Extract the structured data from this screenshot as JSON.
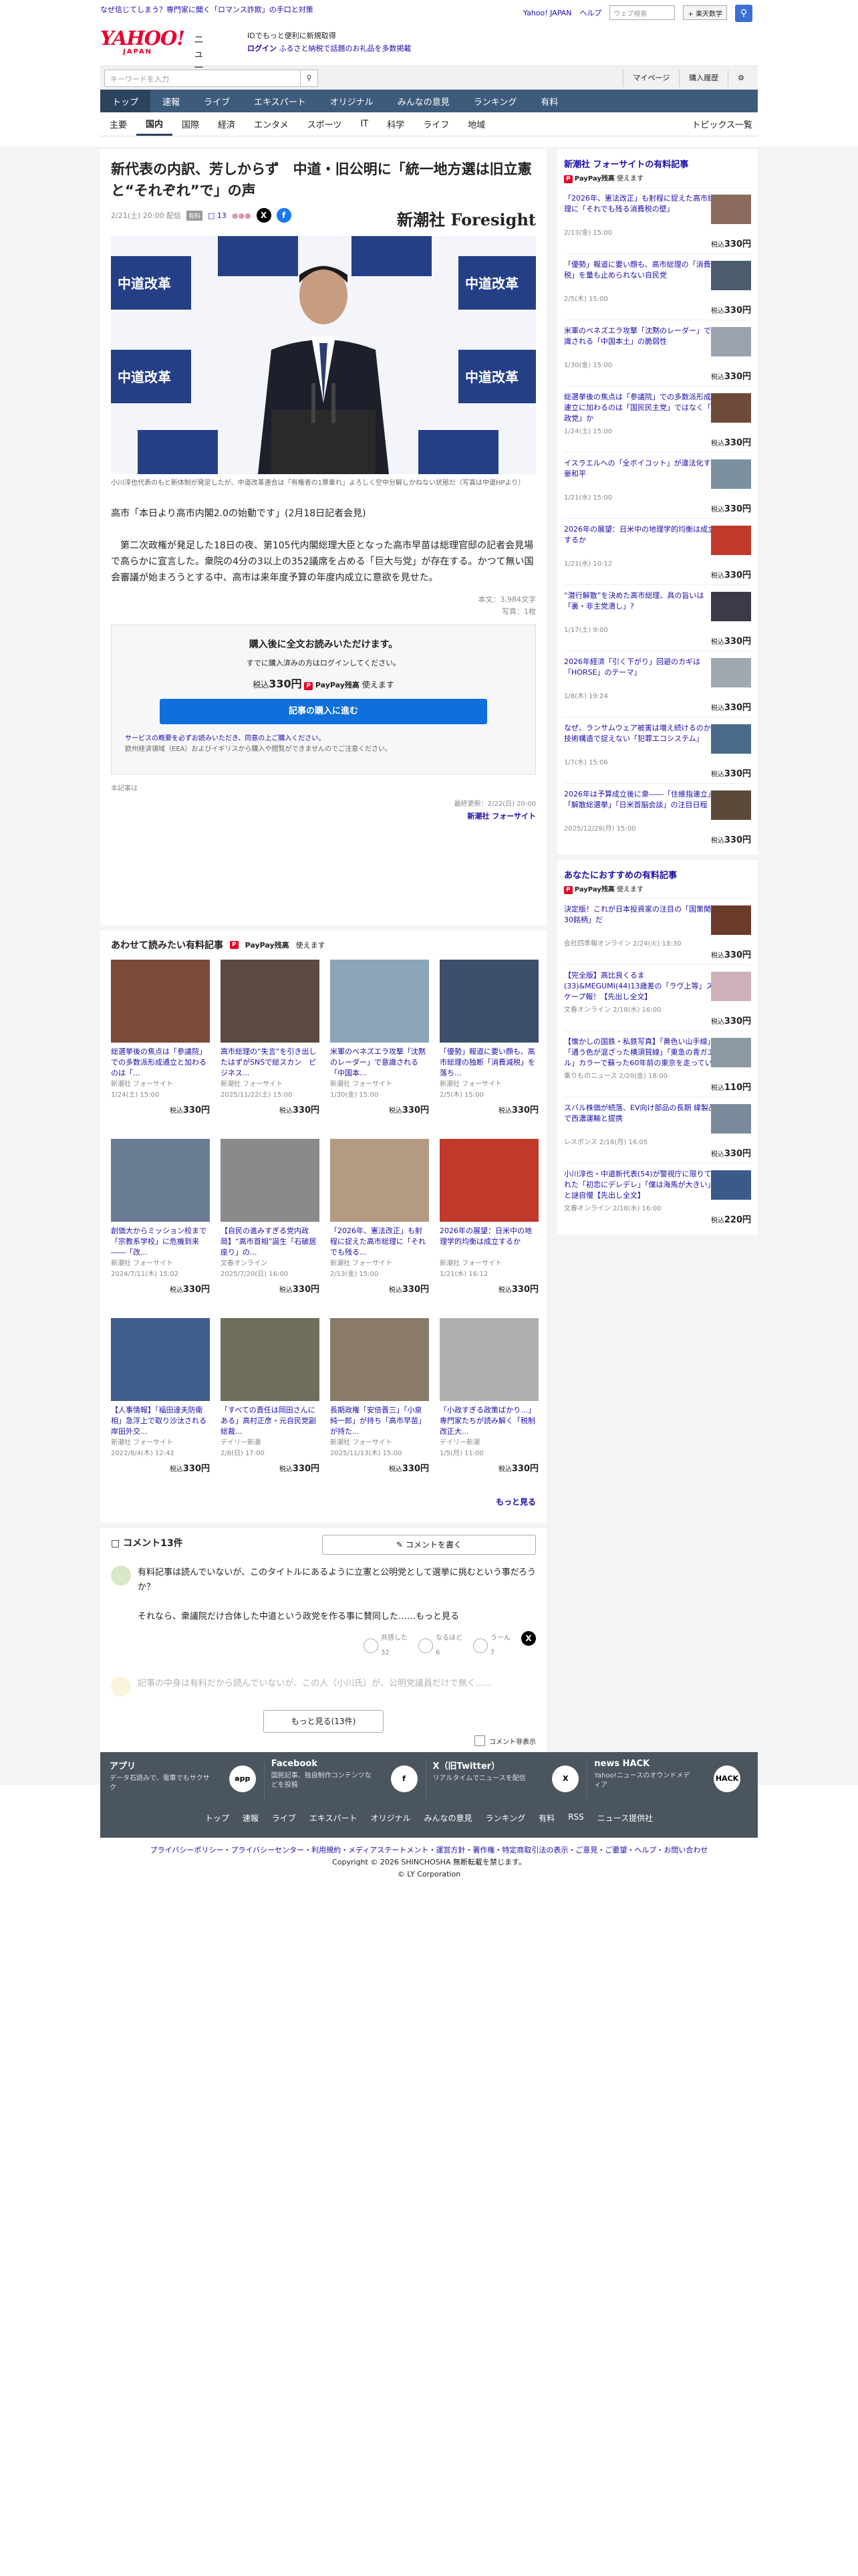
{
  "top_strip": {
    "left": "なぜ信じてしまう？専門家に聞く「ロマンス詐欺」の手口と対策",
    "right_links": [
      "Yahoo! JAPAN",
      "ヘルプ"
    ],
    "search_placeholder": "ウェブ検索",
    "search_button": "+ 楽天数学"
  },
  "header": {
    "logo": "YAHOO!",
    "logo_sub": "JAPAN",
    "service": "ニュース",
    "promo_line1": "IDでもっと便利に新規取得",
    "promo_line2_login": "ログイン",
    "promo_line2": "ふるさと納税で話題のお礼品を多数掲載"
  },
  "toolbar": {
    "search_placeholder": "キーワードを入力",
    "links": [
      "マイページ",
      "購入履歴"
    ]
  },
  "main_nav": [
    "トップ",
    "速報",
    "ライブ",
    "エキスパート",
    "オリジナル",
    "みんなの意見",
    "ランキング",
    "有料"
  ],
  "sub_nav": [
    "主要",
    "国内",
    "国際",
    "経済",
    "エンタメ",
    "スポーツ",
    "IT",
    "科学",
    "ライフ",
    "地域"
  ],
  "sub_nav_right": "トピックス一覧",
  "article": {
    "title": "新代表の内訳、芳しからず　中道・旧公明に「統一地方選は旧立憲と“それぞれ”で」の声",
    "date": "2/21(土) 20:00 配信",
    "ad": "有料",
    "comments": "13",
    "publisher": "新潮社 Foresight",
    "photo_sign": "中道改革連合",
    "caption": "小川淳也代表のもと新体制が発足したが、中道改革連合は「有権者の1票乗れ」よろしく空中分解しかねない状態だ（写真は中道HPより）",
    "body": "高市「本日より高市内閣2.0の始動です」(2月18日記者会見)\n\n　第二次政権が発足した18日の夜、第105代内閣総理大臣となった高市早苗は総理官邸の記者会見場で高らかに宣言した。衆院の4分の3以上の352議席を占める「巨大与党」が存在する。かつて無い国会審議が始まろうとする中、高市は来年度予算の年度内成立に意欲を見せた。",
    "chars": "本文：3,984文字",
    "photos": "写真：1枚",
    "paywall_title": "購入後に全文お読みいただけます。",
    "paywall_login": "すでに購入済みの方はログインしてください。",
    "price_label": "税込",
    "price": "330円",
    "paypay": "PayPay残高",
    "paypay_use": "使えます",
    "buy_button": "記事の購入に進む",
    "note1": "サービスの概要を必ずお読みいただき、同意の上ご購入ください。",
    "note2": "欧州経済領域（EEA）およびイギリスから購入や閲覧ができませんのでご注意ください。",
    "publisher_note": "最終更新：2/22(日) 20:00",
    "footer_pub": "新潮社 フォーサイト",
    "origin": "本記事は"
  },
  "related": {
    "title": "あわせて読みたい有料記事",
    "paypay": "PayPay残高",
    "paypay_use": "使えます",
    "more": "もっと見る",
    "items": [
      {
        "title": "総選挙後の焦点は「参議院」での多数派形成通立と加わるのは「...",
        "src": "新潮社 フォーサイト",
        "date": "1/24(土) 15:00",
        "price": "330円"
      },
      {
        "title": "高市総理の“失言”を引き出したはずがSNSで総スカン　ビジネス...",
        "src": "新潮社 フォーサイト",
        "date": "2025/11/22(土) 15:00",
        "price": "330円"
      },
      {
        "title": "米軍のベネズエラ攻撃「沈黙のレーダー」で意識される「中国本...",
        "src": "新潮社 フォーサイト",
        "date": "1/30(金) 15:00",
        "price": "330円"
      },
      {
        "title": "「優勢」報道に要い顔も、高市総理の独断「消費減税」を落ち...",
        "src": "新潮社 フォーサイト",
        "date": "2/5(木) 15:00",
        "price": "330円"
      },
      {
        "title": "創価大からミッション校まで「宗教系学校」に危機到来――「改...",
        "src": "新潮社 フォーサイト",
        "date": "2024/7/11(木) 15:02",
        "price": "330円"
      },
      {
        "title": "【自民の進みすぎる党内政局】“高市首相”誕生「石破居座り」の...",
        "src": "文春オンライン",
        "date": "2025/7/20(日) 16:00",
        "price": "330円"
      },
      {
        "title": "「2026年、憲法改正」も射程に捉えた高市総理に「それでも残る...",
        "src": "新潮社 フォーサイト",
        "date": "2/13(金) 15:00",
        "price": "330円"
      },
      {
        "title": "2026年の展望：日米中の地理学的均衡は成立するか",
        "src": "新潮社 フォーサイト",
        "date": "1/21(水) 16:12",
        "price": "330円"
      },
      {
        "title": "【人事情報】「福田達夫防衛相」急浮上で取り沙汰される岸田外交...",
        "src": "新潮社 フォーサイト",
        "date": "2022/8/4(木) 12:42",
        "price": "330円"
      },
      {
        "title": "「すべての責任は岡田さんにある」高村正彦・元自民党副総裁...",
        "src": "デイリー新潮",
        "date": "2/8(日) 17:00",
        "price": "330円"
      },
      {
        "title": "長期政権「安倍晋三」「小泉純一郎」が持ち「高市早苗」が持た...",
        "src": "新潮社 フォーサイト",
        "date": "2025/11/13(木) 15:00",
        "price": "330円"
      },
      {
        "title": "「小政すぎる政策ばかり…」専門家たちが読み解く「税制改正大...",
        "src": "デイリー新潮",
        "date": "1/5(月) 11:00",
        "price": "330円"
      }
    ]
  },
  "comments": {
    "title": "コメント13件",
    "write": "コメントを書く",
    "items": [
      {
        "text": "有料記事は読んでいないが、このタイトルにあるように立憲と公明党として選挙に挑むという事だろうか？\n\nそれなら、衆議院だけ合体した中道という政党を作る事に賛同した……もっと見る",
        "r1_label": "共感した",
        "r1": "32",
        "r2_label": "なるほど",
        "r2": "6",
        "r3_label": "うーん",
        "r3": "7"
      },
      {
        "text": "記事の中身は有料だから読んでいないが、この人（小川氏）が、公明党議員だけで無く......",
        "r1_label": "",
        "r1": "",
        "r2_label": "",
        "r2": "",
        "r3_label": "",
        "r3": ""
      }
    ],
    "more": "もっと見る(13件)",
    "hide": "コメント非表示"
  },
  "sidebar": {
    "sec1_title": "新潮社 フォーサイトの有料記事",
    "paypay": "PayPay残高",
    "paypay_use": "使えます",
    "sec1": [
      {
        "t": "「2026年、憲法改正」も射程に捉えた高市総理に「それでも残る消費税の壁」",
        "d": "2/13(金) 15:00",
        "p": "330円"
      },
      {
        "t": "「優勢」報道に要い顔も、高市総理の「消費減税」を量も止められない自民党",
        "d": "2/5(木) 15:00",
        "p": "330円"
      },
      {
        "t": "米軍のベネズエラ攻撃「沈黙のレーダー」で意識される「中国本土」の脆弱性",
        "d": "1/30(金) 15:00",
        "p": "330円"
      },
      {
        "t": "総選挙後の焦点は「参議院」での多数派形成　連立に加わるのは「国民民主党」ではなく「参政党」か",
        "d": "1/24(土) 15:00",
        "p": "330円"
      },
      {
        "t": "イスラエルへの「全ボイコット」が違法化する豪和平",
        "d": "1/21(水) 15:00",
        "p": "330円"
      },
      {
        "t": "2026年の展望：日米中の地理学的均衡は成立するか",
        "d": "1/21(水) 10:12",
        "p": "330円"
      },
      {
        "t": "“潜行解散”を決めた高市総理、具の旨いは「裏・非主党潰し」?",
        "d": "1/17(土) 9:00",
        "p": "330円"
      },
      {
        "t": "2026年経済「引く下がり」回避のカギは「HORSE」のテーマ」",
        "d": "1/8(木) 19:24",
        "p": "330円"
      },
      {
        "t": "なぜ、ランサムウェア被害は増え続けるのか　技術構造で捉えない「犯罪エコシステム」",
        "d": "1/7(水) 15:06",
        "p": "330円"
      },
      {
        "t": "2026年は予算成立後に衆――「住維指連立」「解散総選挙」「日米首脳会談」の注目日程",
        "d": "2025/12/29(月) 15:00",
        "p": "330円"
      }
    ],
    "sec2_title": "あなたにおすすめの有料記事",
    "sec2": [
      {
        "t": "決定版！これが日本投資家の注目の「国策関連30銘柄」だ",
        "d": "会社四季報オンライン 2/24(火) 18:30",
        "p": "330円"
      },
      {
        "t": "【完全版】高比良くるま(33)&MEGUMI(44)13歳差の「ラヴ上等」スケープ報！【先出し全文】",
        "d": "文春オンライン 2/18(水) 16:00",
        "p": "330円"
      },
      {
        "t": "【懐かしの国鉄・私鉄写真】「黄色い山手線」「通う色が混ざった横須賀線」「東急の青ガエル」カラーで蘇った60年前の東京を走っていた鉄道の“色”",
        "d": "乗りものニュース 2/20(金) 18:00",
        "p": "110円"
      },
      {
        "t": "スバル株価が続落、EV向け部品の長期 緯製品で西濃運輸と提携",
        "d": "レスポンス 2/16(月) 16:05",
        "p": "330円"
      },
      {
        "t": "小川淳也・中道新代表(54)が警視庁に限りてられた「初恋にデレデレ」「僕は海馬が大きい」と謎自慢【先出し全文】",
        "d": "文春オンライン 2/18(水) 16:00",
        "p": "220円"
      }
    ]
  },
  "app_bar": [
    {
      "name": "アプリ",
      "desc": "データ石読みで、電車でもサクサク",
      "icon": "app"
    },
    {
      "name": "Facebook",
      "desc": "国民記事、独自制作コンテンツなどを投稿",
      "icon": "f"
    },
    {
      "name": "X（旧Twitter）",
      "desc": "リアルタイムでニュースを配信",
      "icon": "X"
    },
    {
      "name": "news HACK",
      "desc": "Yahoo!ニュースのオウンドメディア",
      "icon": "HACK"
    }
  ],
  "footer_nav": [
    "トップ",
    "速報",
    "ライブ",
    "エキスパート",
    "オリジナル",
    "みんなの意見",
    "ランキング",
    "有料",
    "RSS",
    "ニュース提供社"
  ],
  "legal": {
    "links": "プライバシーポリシー・プライバシーセンター・利用規約・メディアステートメント・運営方針・著作権・特定商取引法の表示・ご意見・ご要望・ヘルプ・お問い合わせ",
    "copy1": "Copyright © 2026 SHINCHOSHA 無断転載を禁じます。",
    "copy2": "© LY Corporation"
  }
}
